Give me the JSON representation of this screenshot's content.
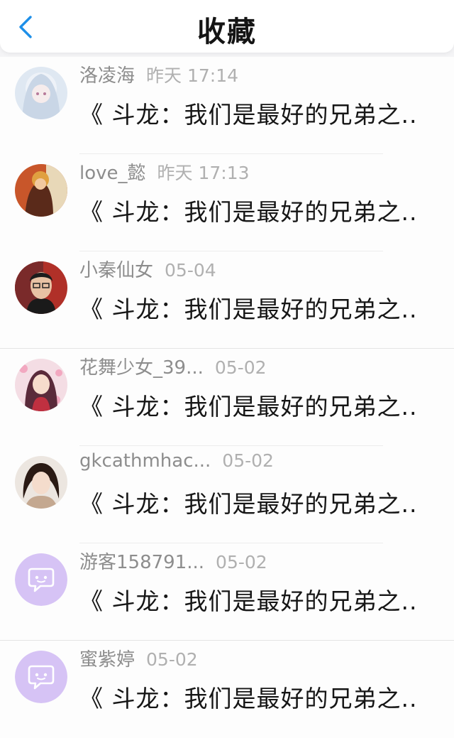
{
  "header": {
    "title": "收藏"
  },
  "colors": {
    "accent": "#1e8fe8",
    "msg_icon_bg": "#d6c3f5"
  },
  "items": [
    {
      "name": "洛凌海",
      "time": "昨天 17:14",
      "text": "《 斗龙：我们是最好的兄弟之...",
      "avatar": "anime-white-hair"
    },
    {
      "name": "love_懿",
      "time": "昨天 17:13",
      "text": "《 斗龙：我们是最好的兄弟之...",
      "avatar": "anime-boy"
    },
    {
      "name": "小秦仙女",
      "time": "05-04",
      "text": "《 斗龙：我们是最好的兄弟之...",
      "avatar": "photo-boy"
    },
    {
      "name": "花舞少女_39...",
      "time": "05-02",
      "text": "《 斗龙：我们是最好的兄弟之...",
      "avatar": "anime-girl-flowers"
    },
    {
      "name": "gkcathmhac...",
      "time": "05-02",
      "text": "《 斗龙：我们是最好的兄弟之...",
      "avatar": "photo-girl"
    },
    {
      "name": "游客158791...",
      "time": "05-02",
      "text": "《 斗龙：我们是最好的兄弟之...",
      "avatar": "chat-bubble-icon"
    },
    {
      "name": "蜜紫婷",
      "time": "05-02",
      "text": "《 斗龙：我们是最好的兄弟之...",
      "avatar": "chat-bubble-icon"
    }
  ]
}
